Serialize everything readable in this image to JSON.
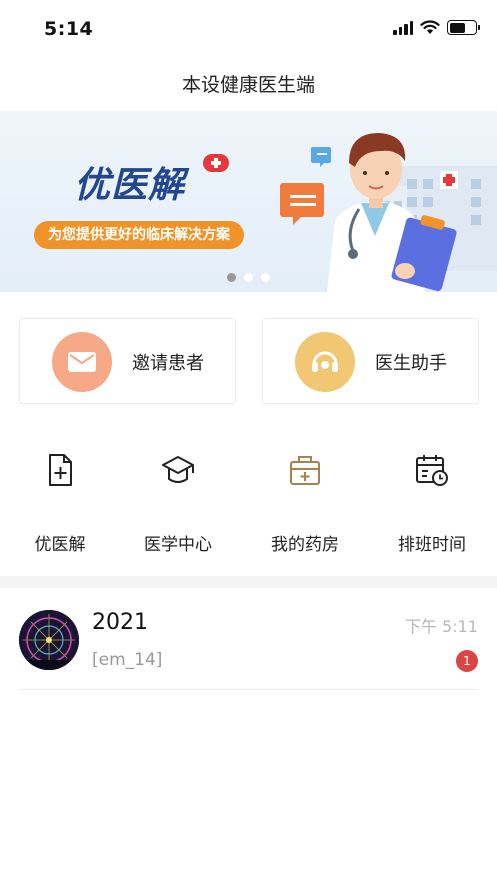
{
  "status_bar": {
    "time": "5:14"
  },
  "nav": {
    "title": "本设健康医生端"
  },
  "banner": {
    "brand": "优医解",
    "slogan": "为您提供更好的临床解决方案",
    "slides": 3,
    "active_slide": 1
  },
  "quick_actions": [
    {
      "label": "邀请患者",
      "icon": "mail-icon",
      "color": "#f5a27a"
    },
    {
      "label": "医生助手",
      "icon": "headset-icon",
      "color": "#f1c36e"
    }
  ],
  "features": [
    {
      "label": "优医解",
      "icon": "document-add-icon"
    },
    {
      "label": "医学中心",
      "icon": "graduation-cap-icon"
    },
    {
      "label": "我的药房",
      "icon": "medicine-box-icon"
    },
    {
      "label": "排班时间",
      "icon": "calendar-clock-icon"
    }
  ],
  "messages": [
    {
      "name": "2021",
      "preview": "[em_14]",
      "time": "下午 5:11",
      "unread": "1"
    }
  ],
  "colors": {
    "accent_orange": "#f0942a",
    "brand_blue": "#22478f",
    "badge_red": "#dc4545"
  }
}
